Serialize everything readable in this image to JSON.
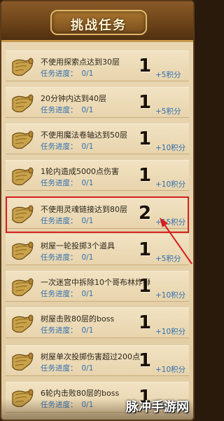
{
  "header": {
    "title": "挑战任务"
  },
  "progress_label": "任务进度：",
  "tasks": [
    {
      "name": "不使用探索点达到30层",
      "progress": "0/1",
      "count": "1",
      "reward": "+5积分"
    },
    {
      "name": "20分钟内达到40层",
      "progress": "0/1",
      "count": "1",
      "reward": "+5积分"
    },
    {
      "name": "不使用魔法卷轴达到50层",
      "progress": "0/1",
      "count": "1",
      "reward": "+10积分"
    },
    {
      "name": "1轮内造成5000点伤害",
      "progress": "0/1",
      "count": "1",
      "reward": "+10积分"
    },
    {
      "name": "不使用灵魂链接达到80层",
      "progress": "0/1",
      "count": "2",
      "reward": "+15积分"
    },
    {
      "name": "树屋一轮投掷3个道具",
      "progress": "0/1",
      "count": "1",
      "reward": "+5积分"
    },
    {
      "name": "一次迷宫中拆除10个哥布林炸弹",
      "progress": "0/1",
      "count": "1",
      "reward": "+10积分"
    },
    {
      "name": "树屋击败80层的boss",
      "progress": "0/1",
      "count": "1",
      "reward": "+10积分"
    },
    {
      "name": "树屋单次投掷伤害超过200点",
      "progress": "0/1",
      "count": "1",
      "reward": "+10积分"
    },
    {
      "name": "6轮内击败80层的boss",
      "progress": "0/1",
      "count": "1",
      "reward": "+15积分"
    }
  ],
  "watermark": "脉冲手游网",
  "colors": {
    "highlight": "#d41f1f",
    "progress_text": "#2f6fb0",
    "header": "#6a4218"
  }
}
